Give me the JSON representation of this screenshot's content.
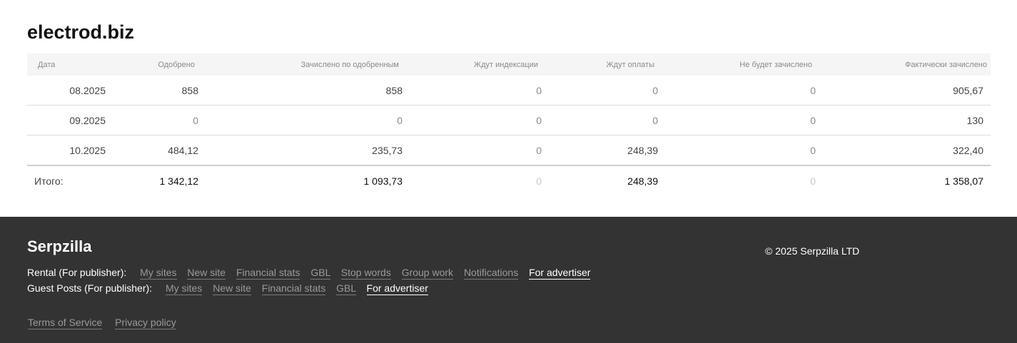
{
  "site": {
    "title": "electrod.biz"
  },
  "table": {
    "headers": [
      "Дата",
      "Одобрено",
      "Зачислено по одобренным",
      "Ждут индексации",
      "Ждут оплаты",
      "Не будет зачислено",
      "Фактически зачислено"
    ],
    "rows": [
      [
        "08.2025",
        "858",
        "858",
        "0",
        "0",
        "0",
        "905,67"
      ],
      [
        "09.2025",
        "0",
        "0",
        "0",
        "0",
        "0",
        "130"
      ],
      [
        "10.2025",
        "484,12",
        "235,73",
        "0",
        "248,39",
        "0",
        "322,40"
      ]
    ],
    "total": [
      "Итого:",
      "1 342,12",
      "1 093,73",
      "0",
      "248,39",
      "0",
      "1 358,07"
    ]
  },
  "footer": {
    "brand": "Serpzilla",
    "copyright": "© 2025 Serpzilla LTD",
    "rental": {
      "label": "Rental (For publisher):",
      "links": [
        "My sites",
        "New site",
        "Financial stats",
        "GBL",
        "Stop words",
        "Group work",
        "Notifications",
        "For advertiser"
      ]
    },
    "guest": {
      "label": "Guest Posts (For publisher):",
      "links": [
        "My sites",
        "New site",
        "Financial stats",
        "GBL",
        "For advertiser"
      ]
    },
    "legal": [
      "Terms of Service",
      "Privacy policy"
    ]
  }
}
